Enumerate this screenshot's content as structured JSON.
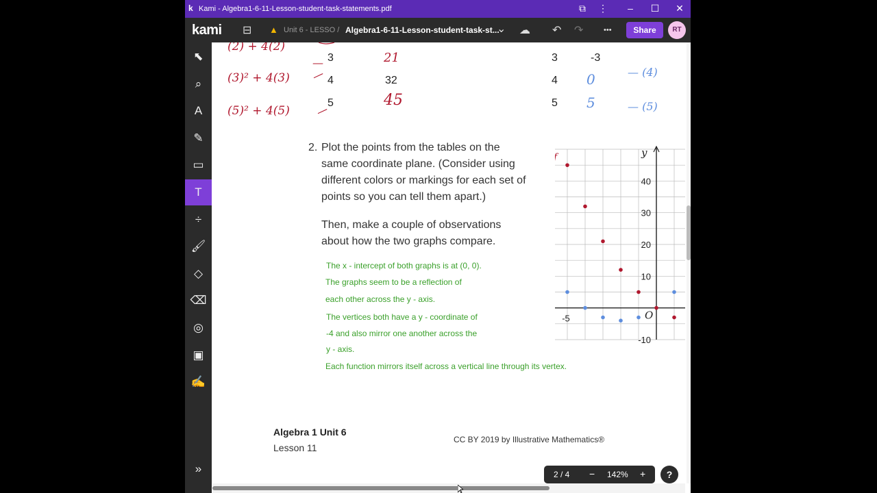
{
  "window": {
    "title": "Kami - Algebra1-6-11-Lesson-student-task-statements.pdf",
    "app_icon": "k",
    "buttons": {
      "extension": "⧉",
      "more": "⋮",
      "minimize": "–",
      "maximize": "☐",
      "close": "✕"
    }
  },
  "toolbar": {
    "logo": "kami",
    "breadcrumb": "Unit 6 - LESSO /",
    "filename": "Algebra1-6-11-Lesson-student-task-st...",
    "icons": {
      "archive": "⊟",
      "drive": "▲",
      "dropdown": "⌄",
      "cloud": "☁",
      "undo": "↶",
      "redo": "↷",
      "more": "•••"
    },
    "share_label": "Share",
    "avatar": "RT",
    "colors": {
      "accent": "#7e3fd8",
      "bar": "#2b2b2b",
      "titlebar": "#5b2bb5"
    }
  },
  "sidebar": {
    "tools": [
      {
        "name": "select-tool-icon",
        "glyph": "⬉"
      },
      {
        "name": "text-recognition-tool-icon",
        "glyph": "⌕"
      },
      {
        "name": "text-to-speech-tool-icon",
        "glyph": "A"
      },
      {
        "name": "highlighter-tool-icon",
        "glyph": "✎"
      },
      {
        "name": "comment-tool-icon",
        "glyph": "▭"
      },
      {
        "name": "text-box-tool-icon",
        "glyph": "T",
        "active": true
      },
      {
        "name": "equation-tool-icon",
        "glyph": "÷"
      },
      {
        "name": "drawing-tool-icon",
        "glyph": "🖌"
      },
      {
        "name": "shapes-tool-icon",
        "glyph": "◇"
      },
      {
        "name": "eraser-tool-icon",
        "glyph": "⌫"
      },
      {
        "name": "ai-tool-icon",
        "glyph": "◎"
      },
      {
        "name": "image-tool-icon",
        "glyph": "▣"
      },
      {
        "name": "signature-tool-icon",
        "glyph": "✍"
      }
    ],
    "expand": "»"
  },
  "document": {
    "handwriting_top": {
      "red_exprs": [
        "(2) + 4(2)",
        "(3)² + 4(3)",
        "(5)² + 4(5)"
      ],
      "red_marks": [
        "—",
        "—",
        "—"
      ],
      "table_left": {
        "x": [
          "3",
          "4",
          "5"
        ],
        "y": [
          "21",
          "32",
          "45"
        ]
      },
      "table_right": {
        "x": [
          "3",
          "4",
          "5"
        ],
        "y": [
          "-3",
          "0",
          "5"
        ]
      },
      "blue_notes": [
        "— (4)",
        "— (5)"
      ]
    },
    "question_number": "2.",
    "question_lines": [
      "Plot the points from the tables on the",
      "same coordinate plane. (Consider using",
      "different colors or markings for each set of",
      "points so you can tell them apart.)"
    ],
    "then_lines": [
      "Then, make a couple of observations",
      "about how the two graphs compare."
    ],
    "answers": [
      "The x - intercept of both graphs is at (0, 0).",
      "The graphs seem to be a reflection of",
      "each other across the y - axis.",
      "The vertices both have a y - coordinate of",
      "-4 and also mirror one another across the",
      "y - axis.",
      "Each function mirrors itself across a vertical line through its vertex."
    ],
    "footer": {
      "course": "Algebra 1 Unit 6",
      "lesson": "Lesson 11",
      "license": "CC BY 2019 by Illustrative Mathematics®"
    },
    "graph_label_f": "f"
  },
  "chart_data": {
    "type": "scatter",
    "xlabel": "",
    "ylabel": "y",
    "origin_label": "O",
    "xlim": [
      -5,
      1
    ],
    "ylim": [
      -10,
      50
    ],
    "x_tick_labels": [
      {
        "value": -5,
        "label": "-5"
      }
    ],
    "y_tick_labels": [
      {
        "value": 40,
        "label": "40"
      },
      {
        "value": 30,
        "label": "30"
      },
      {
        "value": 20,
        "label": "20"
      },
      {
        "value": 10,
        "label": "10"
      },
      {
        "value": -10,
        "label": "-10"
      }
    ],
    "grid": true,
    "series": [
      {
        "color": "#b0182e",
        "points": [
          [
            -5,
            45
          ],
          [
            -4,
            32
          ],
          [
            -3,
            21
          ],
          [
            -2,
            12
          ],
          [
            -1,
            5
          ],
          [
            0,
            0
          ],
          [
            1,
            -3
          ]
        ]
      },
      {
        "color": "#5e8ede",
        "points": [
          [
            -5,
            5
          ],
          [
            -4,
            0
          ],
          [
            -3,
            -3
          ],
          [
            -2,
            -4
          ],
          [
            -1,
            -3
          ],
          [
            1,
            5
          ]
        ]
      }
    ]
  },
  "zoom": {
    "page": "2 / 4",
    "minus": "−",
    "level": "142%",
    "plus": "+"
  },
  "help": "?"
}
